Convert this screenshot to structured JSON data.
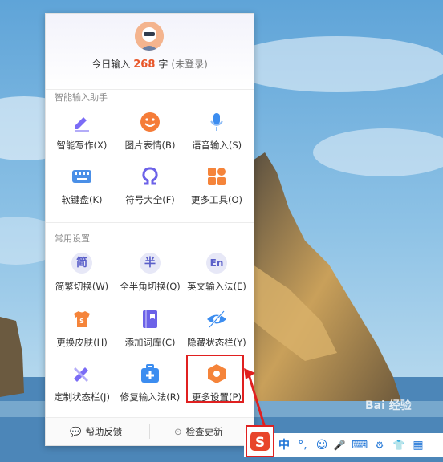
{
  "header": {
    "count_prefix": "今日输入",
    "count_value": "268",
    "count_unit": "字",
    "login_status": "(未登录)"
  },
  "sections": {
    "assistant_title": "智能输入助手",
    "settings_title": "常用设置"
  },
  "assistant_items": [
    {
      "label": "智能写作(X)",
      "icon": "pen-icon",
      "color": "#7b6cf6"
    },
    {
      "label": "图片表情(B)",
      "icon": "smile-icon",
      "color": "#f57c38"
    },
    {
      "label": "语音输入(S)",
      "icon": "microphone-icon",
      "color": "#3c8df0"
    },
    {
      "label": "软键盘(K)",
      "icon": "keyboard-icon",
      "color": "#4a8fe7"
    },
    {
      "label": "符号大全(F)",
      "icon": "omega-icon",
      "color": "#6c62e8"
    },
    {
      "label": "更多工具(O)",
      "icon": "grid-icon",
      "color": "#f5843a"
    }
  ],
  "settings_items": [
    {
      "label": "简繁切换(W)",
      "icon": "simplified-traditional-icon",
      "glyph": "简"
    },
    {
      "label": "全半角切换(Q)",
      "icon": "full-half-width-icon",
      "glyph": "半"
    },
    {
      "label": "英文输入法(E)",
      "icon": "english-icon",
      "glyph": "En"
    },
    {
      "label": "更换皮肤(H)",
      "icon": "skin-shirt-icon",
      "color": "#f5843a"
    },
    {
      "label": "添加词库(C)",
      "icon": "dictionary-icon",
      "color": "#6c62e8"
    },
    {
      "label": "隐藏状态栏(Y)",
      "icon": "hide-eye-icon",
      "color": "#3c8df0"
    },
    {
      "label": "定制状态栏(J)",
      "icon": "customize-tools-icon",
      "color": "#7b6cf6"
    },
    {
      "label": "修复输入法(R)",
      "icon": "repair-kit-icon",
      "color": "#3c8df0"
    },
    {
      "label": "更多设置(P)",
      "icon": "settings-hexagon-icon",
      "color": "#f5843a"
    }
  ],
  "footer": {
    "feedback": "帮助反馈",
    "update": "检查更新"
  },
  "taskbar": {
    "lang": "中",
    "punct": "°,",
    "emoji": "☺",
    "mic": "🎤",
    "keyboard": "⌨",
    "skin": "👕",
    "apps": "▦"
  },
  "watermark": "Bai 经验",
  "colors": {
    "accent": "#e8572a",
    "highlight": "#e02020"
  }
}
